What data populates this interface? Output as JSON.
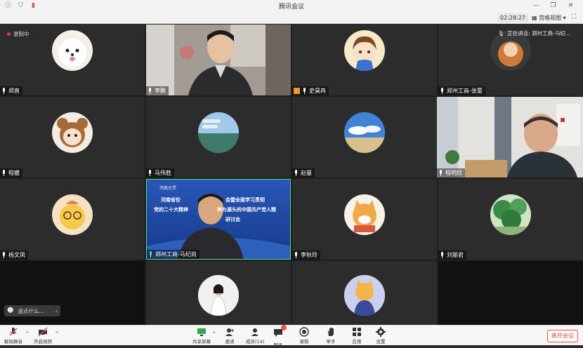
{
  "window": {
    "title": "腾讯会议"
  },
  "header": {
    "timer": "02:28:27",
    "grid_view_label": "宫格视图"
  },
  "recording_label": "录制中",
  "speaking_label": "正在讲话: 郑州工商-马纪...",
  "chat_placeholder": "说点什么...",
  "participants": [
    {
      "name": "郑直"
    },
    {
      "name": "李鹏"
    },
    {
      "name": "史昊冉"
    },
    {
      "name": "郑州工商-张蕾"
    },
    {
      "name": "程媛"
    },
    {
      "name": "马伟胜"
    },
    {
      "name": "赵曼"
    },
    {
      "name": "程明欣"
    },
    {
      "name": "杨文凤"
    },
    {
      "name": "郑州工商-马纪尚"
    },
    {
      "name": "李秋玲"
    },
    {
      "name": "刘丽君"
    },
    {
      "name": ""
    },
    {
      "name": ""
    }
  ],
  "slide": {
    "line1": "河南省伦",
    "line1b": "会暨全面学习贯彻",
    "line2": "党的二十大精神",
    "line2b": "神为源头的中国共产党人精",
    "line3": "研讨会"
  },
  "toolbar": {
    "unmute": "解除静音",
    "video": "开启视频",
    "share": "共享屏幕",
    "invite": "邀请",
    "members": "成员(14)",
    "chat": "聊天",
    "record": "录制",
    "raise_hand": "举手",
    "apps": "应用",
    "settings": "设置",
    "leave": "离开会议"
  },
  "colors": {
    "accent": "#1e6fe8",
    "danger": "#e34d4d",
    "dark_tile": "#2c2c2c"
  }
}
